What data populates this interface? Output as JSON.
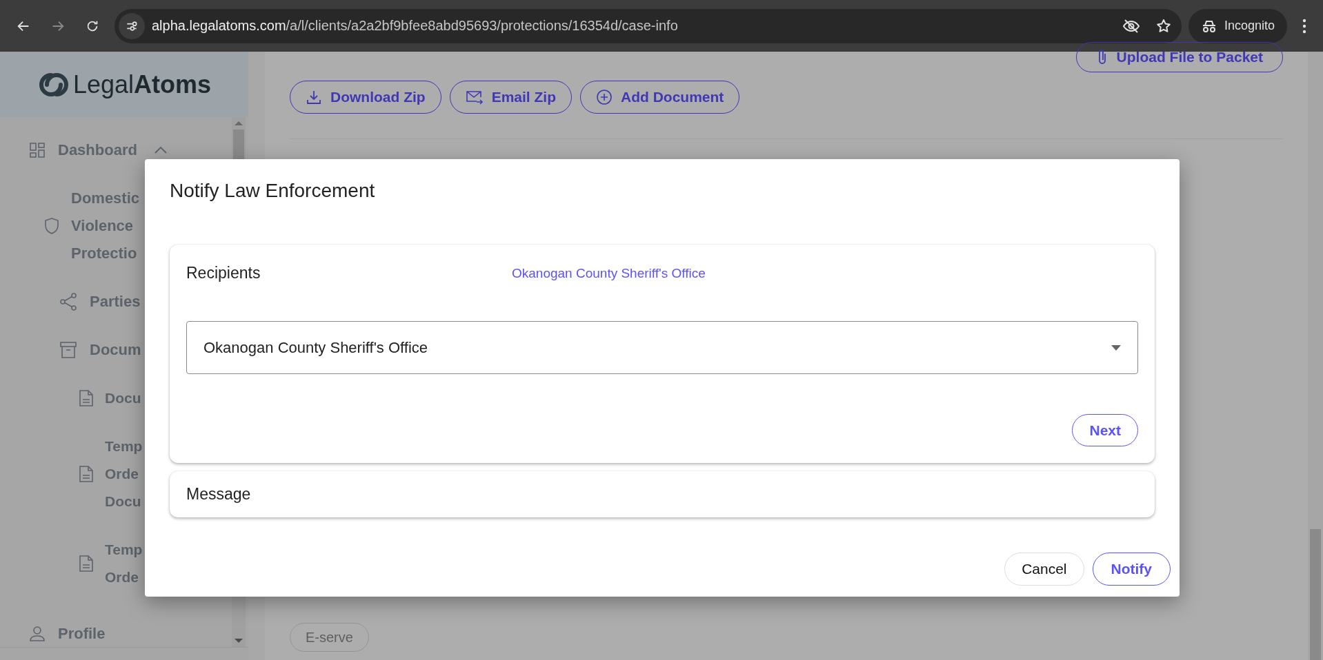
{
  "browser": {
    "nav": [
      {
        "kind": "back",
        "disabled": false
      },
      {
        "kind": "forward",
        "disabled": true
      },
      {
        "kind": "reload",
        "disabled": false
      }
    ],
    "url_host": "alpha.legalatoms.com",
    "url_path": "/a/l/clients/a2a2bf9bfee8abd95693/protections/16354d/case-info",
    "profile": "Incognito"
  },
  "sidebar": {
    "logo": "Legal**Atoms**",
    "items": [
      {
        "kind": "dashboard",
        "lines": [
          "Dashboard"
        ],
        "expanded": true,
        "children": [
          {
            "kind": "case",
            "lines": [
              "Domestic",
              "Violence",
              "Protectio"
            ]
          },
          {
            "kind": "parties",
            "lines": [
              "Parties"
            ]
          },
          {
            "kind": "documents",
            "lines": [
              "Docum"
            ],
            "children": [
              {
                "kind": "document",
                "lines": [
                  "Docu"
                ]
              },
              {
                "kind": "document",
                "lines": [
                  "Temp",
                  "Orde",
                  "Docu"
                ]
              },
              {
                "kind": "document",
                "lines": [
                  "Temp",
                  "Orde"
                ]
              }
            ]
          }
        ]
      },
      {
        "kind": "profile",
        "lines": [
          "Profile"
        ]
      }
    ]
  },
  "main": {
    "upload": "Upload File to Packet",
    "actions": [
      {
        "kind": "download",
        "label": "Download Zip"
      },
      {
        "kind": "email",
        "label": "Email Zip"
      },
      {
        "kind": "add",
        "label": "Add Document"
      }
    ],
    "eserve": {
      "label": "E-serve",
      "disabled": true
    }
  },
  "modal": {
    "title": "Notify Law Enforcement",
    "recipients": {
      "label": "Recipients",
      "summary": "Okanogan County Sheriff's Office",
      "value": "Okanogan County Sheriff's Office",
      "next": "Next"
    },
    "message": {
      "label": "Message"
    },
    "buttons": [
      {
        "kind": "cancel",
        "label": "Cancel"
      },
      {
        "kind": "primary",
        "label": "Notify"
      }
    ]
  }
}
